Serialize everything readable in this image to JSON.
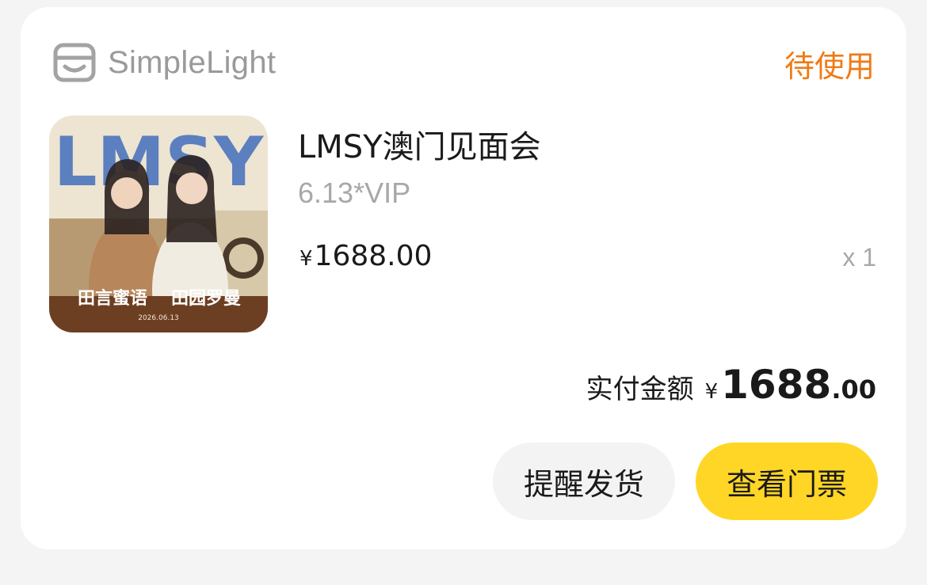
{
  "brand": {
    "name": "SimpleLight",
    "icon": "shop-icon"
  },
  "order": {
    "status": "待使用",
    "product": {
      "title": "LMSY澳门见面会",
      "variant": "6.13*VIP",
      "currency": "¥",
      "price": "1688.00",
      "quantity": "x 1",
      "poster": {
        "headline": "LMSY",
        "names": [
          "田言蜜语",
          "田园罗曼"
        ],
        "date": "2026.06.13"
      }
    },
    "total": {
      "label": "实付金额",
      "currency": "¥",
      "integer": "1688",
      "decimal": ".00"
    }
  },
  "actions": {
    "remind": "提醒发货",
    "view_ticket": "查看门票"
  },
  "colors": {
    "status": "#f07a16",
    "primary_button": "#ffd625",
    "secondary_button": "#f3f3f3"
  }
}
